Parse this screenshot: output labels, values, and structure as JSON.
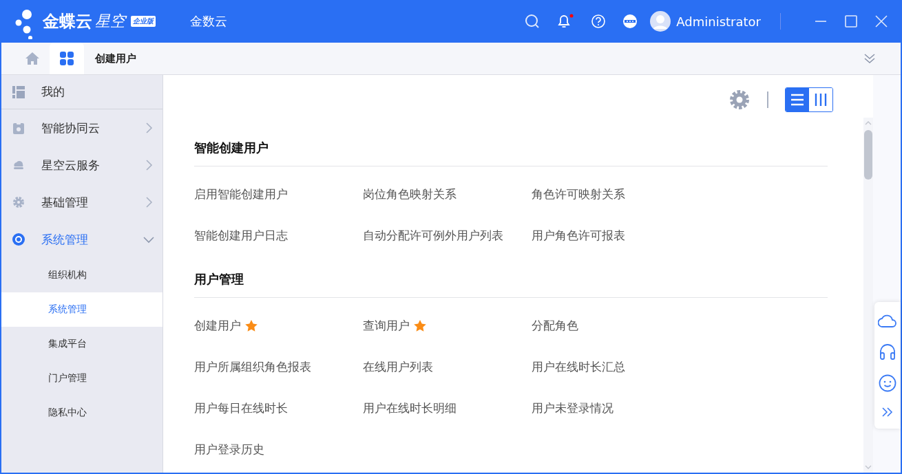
{
  "header": {
    "brand": "金蝶云",
    "product": "星空",
    "edition": "企业版",
    "app_name": "金数云",
    "notification_unread": true,
    "user": "Administrator"
  },
  "page_tab": {
    "label": "创建用户"
  },
  "sidebar": {
    "items": [
      {
        "label": "我的",
        "selected": false
      },
      {
        "label": "智能协同云",
        "expanded": false,
        "selected": false
      },
      {
        "label": "星空云服务",
        "expanded": false,
        "selected": false
      },
      {
        "label": "基础管理",
        "expanded": false,
        "selected": false
      },
      {
        "label": "系统管理",
        "expanded": true,
        "selected": true,
        "children": [
          {
            "label": "组织机构",
            "selected": false
          },
          {
            "label": "系统管理",
            "selected": true
          },
          {
            "label": "集成平台",
            "selected": false
          },
          {
            "label": "门户管理",
            "selected": false
          },
          {
            "label": "隐私中心",
            "selected": false
          }
        ]
      }
    ]
  },
  "view_toggle": [
    {
      "kind": "list",
      "selected": true
    },
    {
      "kind": "columns",
      "selected": false
    }
  ],
  "sections": [
    {
      "title": "智能创建用户",
      "links": [
        {
          "label": "启用智能创建用户",
          "starred": false
        },
        {
          "label": "岗位角色映射关系",
          "starred": false
        },
        {
          "label": "角色许可映射关系",
          "starred": false
        },
        {
          "label": "智能创建用户日志",
          "starred": false
        },
        {
          "label": "自动分配许可例外用户列表",
          "starred": false
        },
        {
          "label": "用户角色许可报表",
          "starred": false
        }
      ]
    },
    {
      "title": "用户管理",
      "links": [
        {
          "label": "创建用户",
          "starred": true
        },
        {
          "label": "查询用户",
          "starred": true
        },
        {
          "label": "分配角色",
          "starred": false
        },
        {
          "label": "用户所属组织角色报表",
          "starred": false
        },
        {
          "label": "在线用户列表",
          "starred": false
        },
        {
          "label": "用户在线时长汇总",
          "starred": false
        },
        {
          "label": "用户每日在线时长",
          "starred": false
        },
        {
          "label": "用户在线时长明细",
          "starred": false
        },
        {
          "label": "用户未登录情况",
          "starred": false
        },
        {
          "label": "用户登录历史",
          "starred": false
        }
      ]
    }
  ]
}
